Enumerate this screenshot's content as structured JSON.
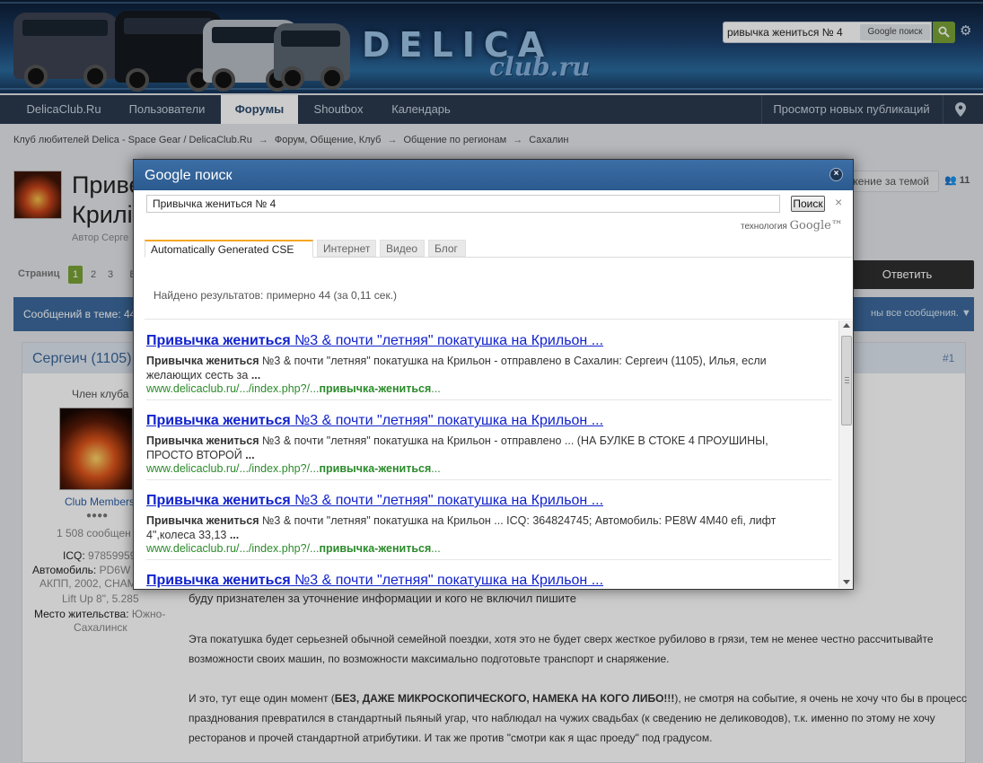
{
  "header": {
    "logo_top": "DELICA",
    "logo_bottom": "club.ru",
    "search_value": "ривычка жениться № 4",
    "search_scope": "Google поиск"
  },
  "nav": {
    "items": [
      "DelicaClub.Ru",
      "Пользователи",
      "Форумы",
      "Shoutbox",
      "Календарь"
    ],
    "active": "Форумы",
    "new_posts": "Просмотр новых публикаций"
  },
  "breadcrumb": [
    "Клуб любителей Delica - Space Gear / DelicaClub.Ru",
    "Форум, Общение, Клуб",
    "Общение по регионам",
    "Сахалин"
  ],
  "breadcrumb_sep": "→",
  "topic": {
    "title_line1": "Приве",
    "title_line2": "Крилі",
    "author": "Автор Серге",
    "follow_label": "жение за темой",
    "follow_count": "11",
    "pager_label": "Страниц",
    "pages": [
      "1",
      "2",
      "3",
      "Б"
    ],
    "reply_label": "Ответить",
    "messages_label": "Сообщений в теме: 44",
    "show_all": "ны все сообщения. ▼"
  },
  "post": {
    "author": "Сергеич (1105)",
    "number": "#1",
    "member_title": "Член клуба",
    "member_group": "Club Members",
    "pips": "●●●●",
    "post_count": "1 508 сообщен",
    "icq_label": "ICQ:",
    "icq_value": "97859959",
    "car_label": "Автомобиль:",
    "car_value": "PD6W",
    "car_line2": "АКПП, 2002, CHAM",
    "car_line3": "Lift Up 8\", 5.285",
    "location_label": "Место жительства:",
    "location_value": "Южно-",
    "location_line2": "Сахалинск",
    "text_line0": "буду признателен за уточнение информации и кого не включил пишите",
    "text_line1": "Эта покатушка будет серьезней обычной семейной поездки, хотя это не будет сверх жесткое рубилово в грязи, тем не менее честно рассчитывайте",
    "text_line2": "возможности своих машин, по возможности максимально подготовьте транспорт и снаряжение.",
    "text_line3_pre": "И это, тут еще один момент (",
    "text_line3_bold": "БЕЗ, ДАЖЕ МИКРОСКОПИЧЕСКОГО, НАМЕКА НА КОГО ЛИБО!!!",
    "text_line3_post": "), не смотря на событие, я очень не хочу что бы в процесс",
    "text_line4": "празднования превратился в стандартный пьяный угар, что наблюдал на чужих свадьбах (к сведению не делиководов), т.к. именно по этому не хочу",
    "text_line5": "ресторанов и прочей стандартной атрибутики. И так же против \"смотри как я щас проеду\" под градусом."
  },
  "modal": {
    "title": "Google поиск",
    "close": "×",
    "query": "Привычка жениться № 4",
    "search_button": "Поиск",
    "clear": "×",
    "powered_prefix": "технология",
    "powered_brand": "Google™",
    "tabs": [
      "Automatically Generated CSE",
      "Интернет",
      "Видео",
      "Блог"
    ],
    "active_tab": "Automatically Generated CSE",
    "stats": "Найдено результатов: примерно 44 (за 0,11 сек.)",
    "results": [
      {
        "title_bold": "Привычка жениться",
        "title_rest": " №3 & почти \"летняя\" покатушка на Крильон ...",
        "snippet_line1_bold": "Привычка жениться",
        "snippet_line1_rest": " №3 & почти \"летняя\" покатушка на Крильон - отправлено в Сахалин: Сергеич (1105), Илья, если",
        "snippet_line2": "желающих сесть за ",
        "snippet_line2_bold": "...",
        "url_prefix": "www.delicaclub.ru/.../index.php?/...",
        "url_bold": "привычка-жениться",
        "url_suffix": "..."
      },
      {
        "title_bold": "Привычка жениться",
        "title_rest": " №3 & почти \"летняя\" покатушка на Крильон ...",
        "snippet_line1_bold": "Привычка жениться",
        "snippet_line1_rest": " №3 & почти \"летняя\" покатушка на Крильон - отправлено ... (НА БУЛКЕ В СТОКЕ 4 ПРОУШИНЫ,",
        "snippet_line2": "ПРОСТО ВТОРОЙ ",
        "snippet_line2_bold": "...",
        "url_prefix": "www.delicaclub.ru/.../index.php?/...",
        "url_bold": "привычка-жениться",
        "url_suffix": "..."
      },
      {
        "title_bold": "Привычка жениться",
        "title_rest": " №3 & почти \"летняя\" покатушка на Крильон ...",
        "snippet_line1_bold": "Привычка жениться",
        "snippet_line1_rest": " №3 & почти \"летняя\" покатушка на Крильон ... ICQ: 364824745; Автомобиль: PE8W 4M40 efi, лифт",
        "snippet_line2": "4\",колеса 33,13 ",
        "snippet_line2_bold": "...",
        "url_prefix": "www.delicaclub.ru/.../index.php?/...",
        "url_bold": "привычка-жениться",
        "url_suffix": "..."
      },
      {
        "title_bold": "Привычка жениться",
        "title_rest": " №3 & почти \"летняя\" покатушка на Крильон ..."
      }
    ]
  }
}
